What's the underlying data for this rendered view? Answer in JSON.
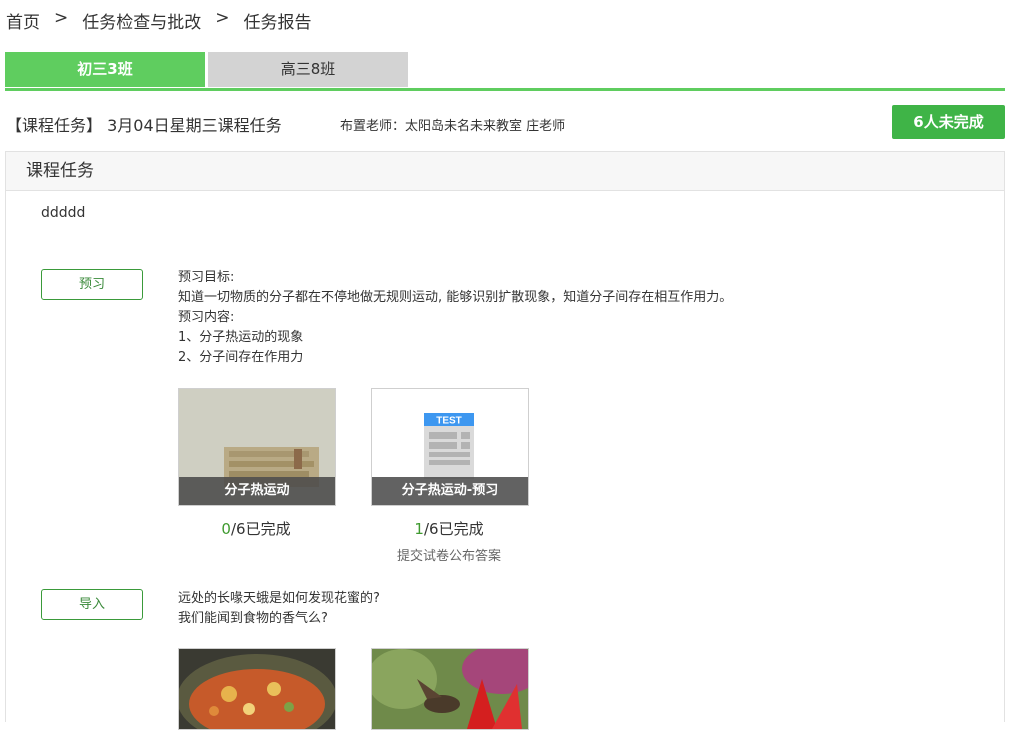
{
  "breadcrumb": {
    "items": [
      "首页",
      "任务检查与批改",
      "任务报告"
    ],
    "separator": ">"
  },
  "tabs": [
    {
      "label": "初三3班",
      "active": true
    },
    {
      "label": "高三8班",
      "active": false
    }
  ],
  "task": {
    "title": "【课程任务】 3月04日星期三课程任务",
    "teacher": "布置老师：太阳岛未名未来教室  庄老师",
    "incomplete_label": "6人未完成"
  },
  "panel": {
    "title": "课程任务",
    "description": "ddddd",
    "sections": [
      {
        "button": "预习",
        "lines": [
          "预习目标:",
          "知道一切物质的分子都在不停地做无规则运动, 能够识别扩散现象，知道分子间存在相互作用力。",
          "预习内容:",
          "1、分子热运动的现象",
          "2、分子间存在作用力"
        ],
        "cards": [
          {
            "caption": "分子热运动",
            "done": "0",
            "total": "/6已完成",
            "note": ""
          },
          {
            "caption": "分子热运动-预习",
            "done": "1",
            "total": "/6已完成",
            "note": "提交试卷公布答案"
          }
        ]
      },
      {
        "button": "导入",
        "lines": [
          "远处的长喙天蛾是如何发现花蜜的?",
          "我们能闻到食物的香气么?"
        ]
      }
    ]
  },
  "test_icon_label": "TEST",
  "colors": {
    "accent": "#5fcd5f",
    "button_green": "#3fb447",
    "done_green": "#3f9a2f"
  }
}
